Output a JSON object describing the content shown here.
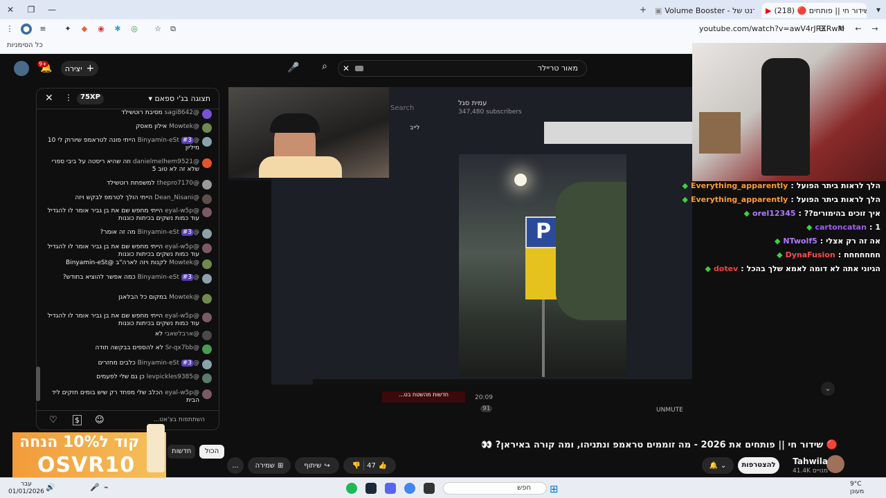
{
  "browser": {
    "tabs": [
      {
        "label": "(218) 🔴 שידור חי || פותחים",
        "icon": "youtube-icon"
      },
      {
        "label": "Volume Booster - האינטרנט של",
        "icon": "extension-icon"
      }
    ],
    "url": "youtube.com/watch?v=awV4rJRXRwM",
    "bookmarks_label": "כל הסימניות"
  },
  "header": {
    "search_query": "מאור טריילר",
    "create_label": "יצירה",
    "notifications_badge": "9+"
  },
  "chat": {
    "title": "תצוגה בג'י ספאם",
    "xp": "75XP",
    "messages": [
      {
        "user": "@sagi8642",
        "text": "מסיבת רוטשילד",
        "badge": "",
        "color": "#7a52d6"
      },
      {
        "user": "@Mowtek",
        "text": "אילון מאסק",
        "badge": "",
        "color": "#6e8a50"
      },
      {
        "user": "@Binyamin-eSt",
        "text": "הייתי פונה לטראמפ שיורוק לי 10 מיליון",
        "badge": "#3",
        "color": "#8aa2aa"
      },
      {
        "user": "@danielmelhem9521",
        "text": "וזה שהיא ריסטה על ביבי ספרי שלא זה לא טוב 5",
        "badge": "",
        "color": "#e5532d"
      },
      {
        "user": "@thepro7170",
        "text": "למשפחת רוטשילד",
        "badge": "",
        "color": "#9a9a9a"
      },
      {
        "user": "@Dean_Nisani",
        "text": "הייתי הולך לטרמפ לבקש ויזה",
        "badge": "",
        "color": "#5a4f4a"
      },
      {
        "user": "@eyal-w5p",
        "text": "הייתי מחפש שם את בן גביר אומר לו להגדיל עוד כמות נשקים בכיתות כוננות",
        "badge": "",
        "color": "#7a5a64"
      },
      {
        "user": "@Binyamin-eSt",
        "text": "מה זה אומר?",
        "badge": "#3",
        "color": "#8aa2aa"
      },
      {
        "user": "@eyal-w5p",
        "text": "הייתי מחפש שם את בן גביר אומר לו להגדיל עוד כמות נשקים בכיתות כוננות",
        "badge": "",
        "color": "#7a5a64"
      },
      {
        "user": "@Mowtek",
        "text": "לקנות ויזה לארה\"ב @Binyamin-eSt",
        "badge": "",
        "color": "#6e8a50"
      },
      {
        "user": "@Binyamin-eSt",
        "text": "כמה אפשר להוציא בחודש?",
        "badge": "#3",
        "color": "#8aa2aa"
      },
      {
        "user": "@Mowtek",
        "text": "במקום כל הבלאגן",
        "badge": "",
        "color": "#6e8a50"
      },
      {
        "user": "@eyal-w5p",
        "text": "הייתי מחפש שם את בן גביר אומר לו להגדיל עוד כמות נשקים בכיתות כוננות",
        "badge": "",
        "color": "#7a5a64"
      },
      {
        "user": "@ארבלשאבי",
        "text": "לא",
        "badge": "",
        "color": "#4a4a4a"
      },
      {
        "user": "@Sr-qx7bb",
        "text": "לא להספים בבקשה תודה",
        "badge": "",
        "color": "#4a9a52"
      },
      {
        "user": "@Binyamin-eSt",
        "text": "כלבים מחזרים",
        "badge": "#3",
        "color": "#8aa2aa"
      },
      {
        "user": "@levpickles9385",
        "text": "כן גם שלי לפעמים",
        "badge": "",
        "color": "#5c7a6a"
      },
      {
        "user": "@eyal-w5p",
        "text": "הכלב שלי מפחד רק שיש בומים חזקים ליד הבית",
        "badge": "",
        "color": "#7a5a64"
      }
    ],
    "input_placeholder": "השתתפות בצ'אט..."
  },
  "video": {
    "overlay_channel": "עמית סגל",
    "overlay_subs": "347,480 subscribers",
    "overlay_search": "Search",
    "overlay_live": "לייב",
    "overlay_news": "חדשות מהשטח בט...",
    "overlay_time": "20:09",
    "overlay_count": "91",
    "unmute_label": "UNMUTE",
    "title": "🔴 שידור חי || פותחים את 2026 - מה זוממים טראמפ ונתניהו, ומה קורה באיראן? 👀"
  },
  "twitch_chat": [
    {
      "user": "Everything_apparently",
      "text": "הלך לראות ביתר הפועל",
      "color": "#ff9b2f"
    },
    {
      "user": "Everything_apparently",
      "text": "הלך לראות ביתר הפועל",
      "color": "#ff9b2f"
    },
    {
      "user": "orel12345",
      "text": "איך זוכים בהימורים??",
      "color": "#b07bff"
    },
    {
      "user": "cartoncatan",
      "text": "1",
      "color": "#a05bff"
    },
    {
      "user": "NTwolf5",
      "text": "אה זה רק אצלי",
      "color": "#b07bff"
    },
    {
      "user": "DynaFusion",
      "text": "חחחחחחח",
      "color": "#ff4b4b"
    },
    {
      "user": "dotev",
      "text": "הגיוני אתה לא דומה לאמא שלך בהכל",
      "color": "#ff3b3b"
    }
  ],
  "channel": {
    "name": "Tahwila",
    "subs": "41.4K מנויים",
    "subscribe_label": "להצטרפות"
  },
  "actions": {
    "likes": "47",
    "share_label": "שיתוף",
    "save_label": "שמירה",
    "more_label": "..."
  },
  "filters": [
    "הכול",
    "חדשות"
  ],
  "ad": {
    "line1": "קוד ל10% הנחה",
    "code": "OSVR10"
  },
  "taskbar": {
    "search_placeholder": "חפש",
    "date": "01/01/2026",
    "day": "עבר",
    "weather": "9°C",
    "weather_desc": "מעונן"
  }
}
